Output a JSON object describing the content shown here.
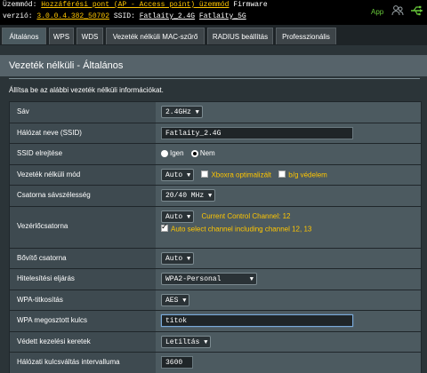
{
  "header": {
    "mode_label": "Üzemmód:",
    "mode_value": "Hozzáférési pont (AP - Access point) üzemmód",
    "firmware_label": "Firmware",
    "version_label": "verzió:",
    "version_value": "3.0.0.4.382_50702",
    "ssid_label": "SSID:",
    "ssid_1": "Fatlaity_2.4G",
    "ssid_2": "Fatlaity_5G",
    "app_label": "App"
  },
  "tabs": [
    "Általános",
    "WPS",
    "WDS",
    "Vezeték nélküli MAC-szűrő",
    "RADIUS beállítás",
    "Professzionális"
  ],
  "section": {
    "title": "Vezeték nélküli - Általános",
    "description": "Állítsa be az alábbi vezeték nélküli információkat."
  },
  "form": {
    "band": {
      "label": "Sáv",
      "value": "2.4GHz"
    },
    "ssid": {
      "label": "Hálózat neve (SSID)",
      "value": "Fatlaity_2.4G"
    },
    "hide_ssid": {
      "label": "SSID elrejtése",
      "yes": "Igen",
      "no": "Nem"
    },
    "wireless_mode": {
      "label": "Vezeték nélküli mód",
      "value": "Auto",
      "xbox": "Xboxra optimalizált",
      "bg": "b/g védelem"
    },
    "bandwidth": {
      "label": "Csatorna sávszélesség",
      "value": "20/40 MHz"
    },
    "control_channel": {
      "label": "Vezérlőcsatorna",
      "value": "Auto",
      "current": "Current Control Channel: 12",
      "auto_select": "Auto select channel including channel 12, 13"
    },
    "ext_channel": {
      "label": "Bővítő csatorna",
      "value": "Auto"
    },
    "auth": {
      "label": "Hitelesítési eljárás",
      "value": "WPA2-Personal"
    },
    "wpa_enc": {
      "label": "WPA-titkosítás",
      "value": "AES"
    },
    "wpa_key": {
      "label": "WPA megosztott kulcs",
      "value": "titok"
    },
    "pmf": {
      "label": "Védett kezelési keretek",
      "value": "Letiltás"
    },
    "key_interval": {
      "label": "Hálózati kulcsváltás intervalluma",
      "value": "3600"
    }
  },
  "colors": {
    "accent": "#ffc600",
    "app_green": "#68c93a"
  }
}
